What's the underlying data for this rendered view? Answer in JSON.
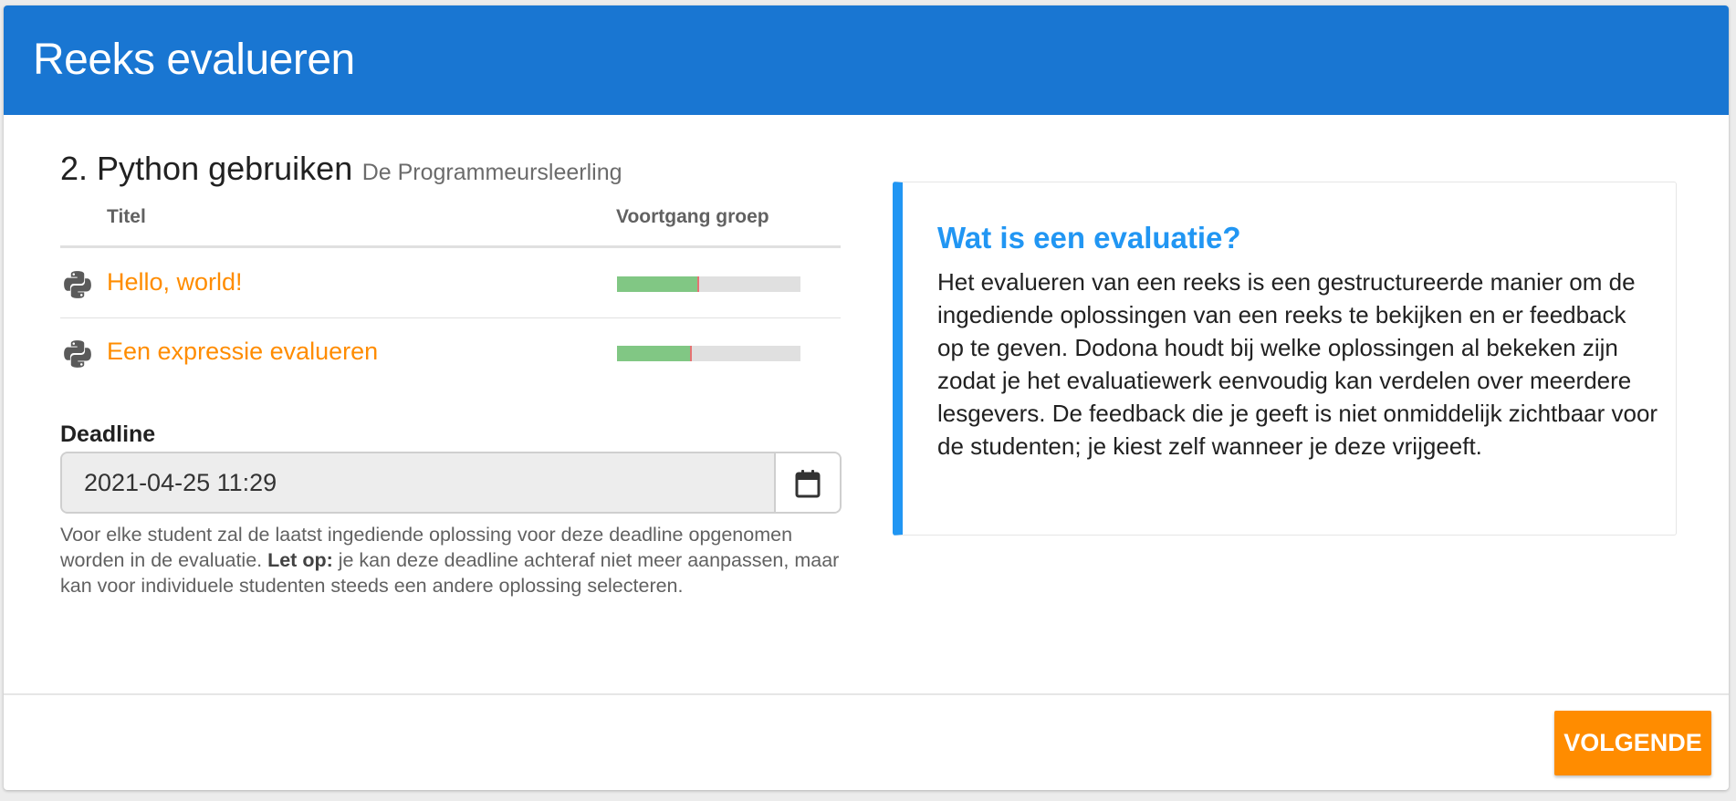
{
  "header": {
    "title": "Reeks evalueren"
  },
  "series": {
    "name": "2. Python gebruiken",
    "course": "De Programmeursleerling"
  },
  "table": {
    "columns": {
      "title": "Titel",
      "progress": "Voortgang groep"
    },
    "rows": [
      {
        "icon": "python-icon",
        "title": "Hello, world!",
        "progress_fraction": 0.44,
        "accent_color": "#ff8c00"
      },
      {
        "icon": "python-icon",
        "title": "Een expressie evalueren",
        "progress_fraction": 0.4,
        "accent_color": "#ff8c00"
      }
    ]
  },
  "deadline": {
    "label": "Deadline",
    "value": "2021-04-25 11:29",
    "calendar_icon": "calendar-icon",
    "help_pre": "Voor elke student zal de laatst ingediende oplossing voor deze deadline opgenomen worden in de evaluatie. ",
    "help_strong": "Let op:",
    "help_post": " je kan deze deadline achteraf niet meer aanpassen, maar kan voor individuele studenten steeds een andere oplossing selecteren."
  },
  "info": {
    "title": "Wat is een evaluatie?",
    "body": "Het evalueren van een reeks is een gestructureerde manier om de ingediende oplossingen van een reeks te bekijken en er feedback op te geven. Dodona houdt bij welke oplossingen al bekeken zijn zodat je het evaluatiewerk eenvoudig kan verdelen over meerdere lesgevers. De feedback die je geeft is niet onmiddelijk zichtbaar voor de studenten; je kiest zelf wanneer je deze vrijgeeft."
  },
  "footer": {
    "next_label": "VOLGENDE"
  },
  "colors": {
    "header": "#1976d2",
    "link": "#ff8c00",
    "info_accent": "#2196f3",
    "progress_done": "#81c784",
    "progress_wrong": "#e57373",
    "button": "#ff8c00"
  }
}
